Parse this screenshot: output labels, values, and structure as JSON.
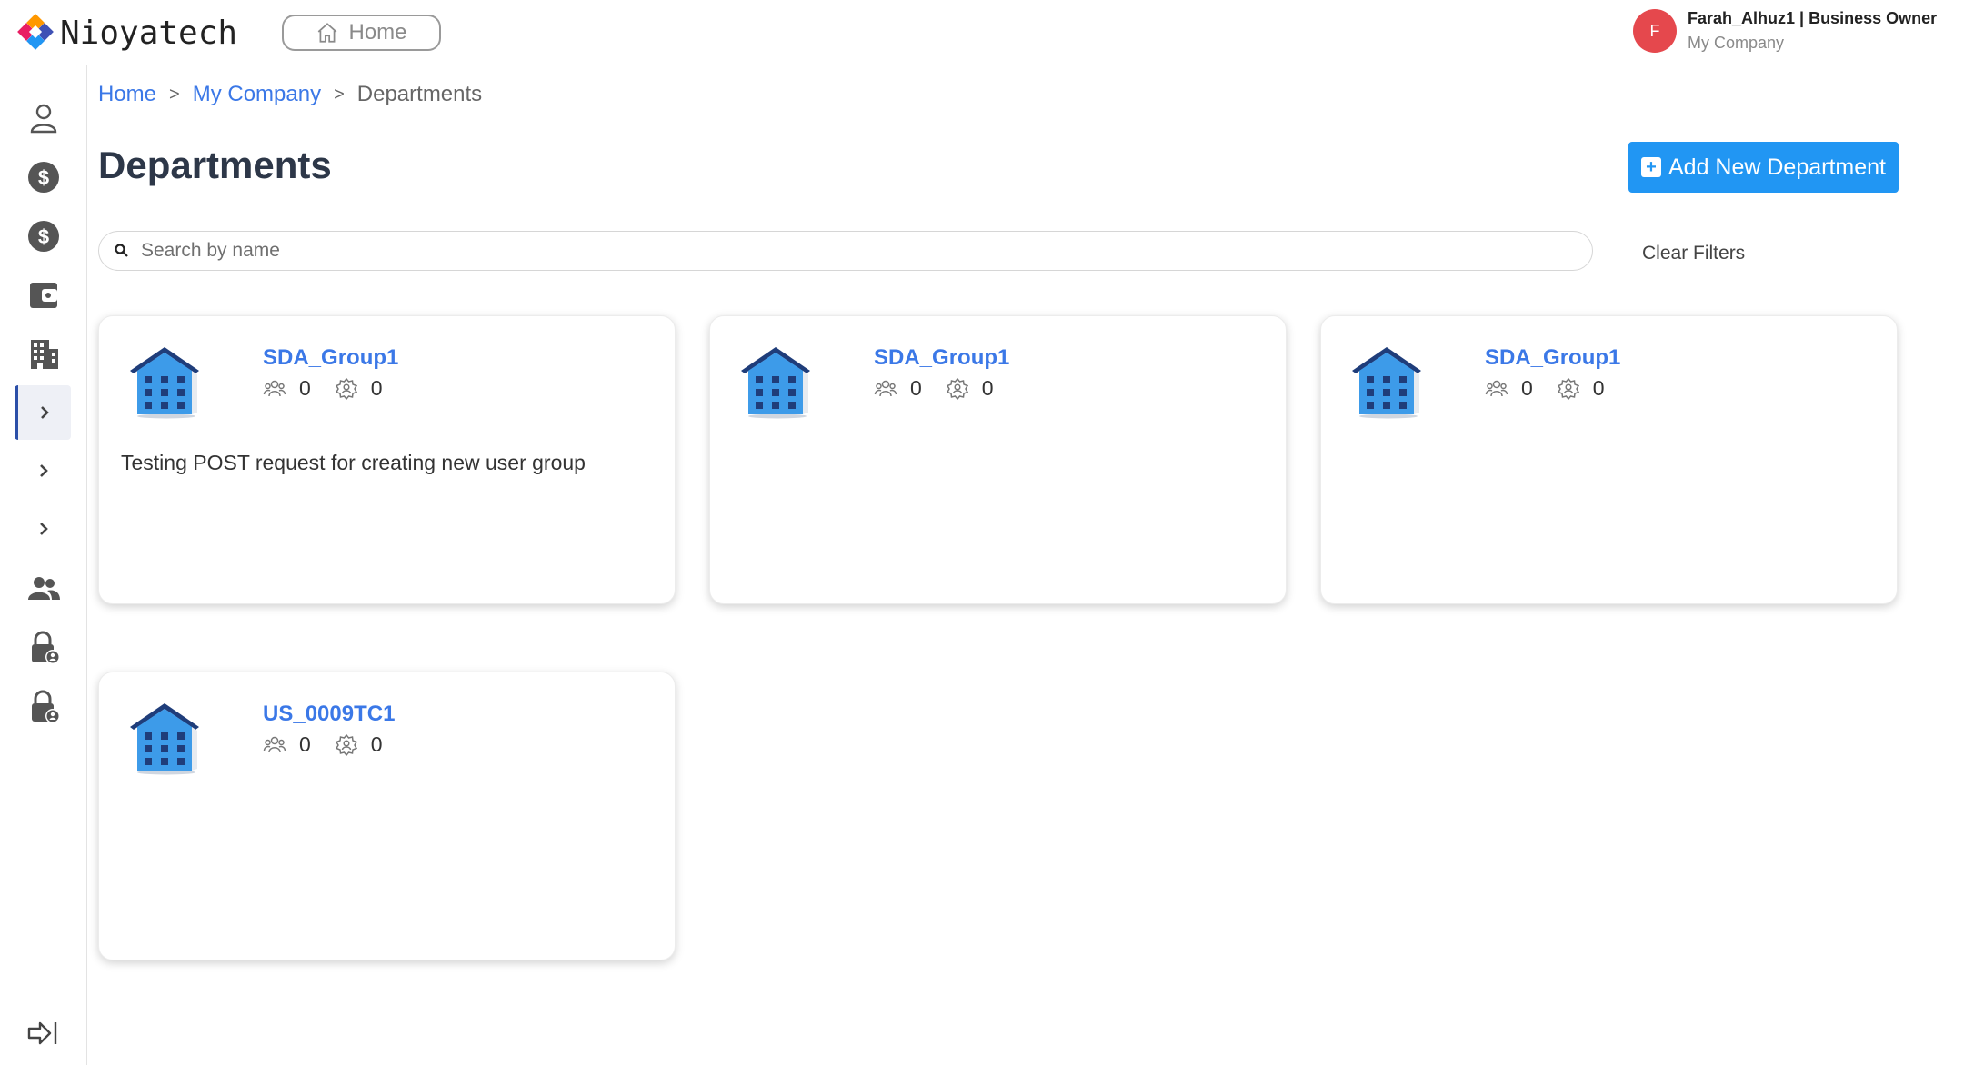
{
  "header": {
    "logo_text": "Nioyatech",
    "home_label": "Home",
    "user": {
      "initial": "F",
      "name_role": "Farah_Alhuz1 | Business Owner",
      "company": "My Company"
    }
  },
  "sidebar": {
    "items": [
      {
        "icon": "user-icon"
      },
      {
        "icon": "dollar-icon"
      },
      {
        "icon": "dollar-icon"
      },
      {
        "icon": "wallet-icon"
      },
      {
        "icon": "building-icon"
      },
      {
        "icon": "chevron-right-icon",
        "active": true
      },
      {
        "icon": "chevron-right-icon"
      },
      {
        "icon": "chevron-right-icon"
      },
      {
        "icon": "users-icon"
      },
      {
        "icon": "lock-user-icon"
      },
      {
        "icon": "lock-user-icon"
      }
    ],
    "footer_icon": "logout-icon"
  },
  "breadcrumb": {
    "items": [
      "Home",
      "My Company",
      "Departments"
    ],
    "separator": ">"
  },
  "page": {
    "title": "Departments",
    "add_button_label": "Add New Department",
    "search_placeholder": "Search by name",
    "clear_filters_label": "Clear Filters"
  },
  "cards": [
    {
      "title": "SDA_Group1",
      "members": "0",
      "roles": "0",
      "description": "Testing POST request for creating new user group"
    },
    {
      "title": "SDA_Group1",
      "members": "0",
      "roles": "0",
      "description": ""
    },
    {
      "title": "SDA_Group1",
      "members": "0",
      "roles": "0",
      "description": ""
    },
    {
      "title": "US_0009TC1",
      "members": "0",
      "roles": "0",
      "description": ""
    }
  ],
  "colors": {
    "accent": "#2196f3",
    "link": "#3b78e7",
    "avatar": "#e5484d",
    "sidebar_active_border": "#2b4fa8"
  }
}
